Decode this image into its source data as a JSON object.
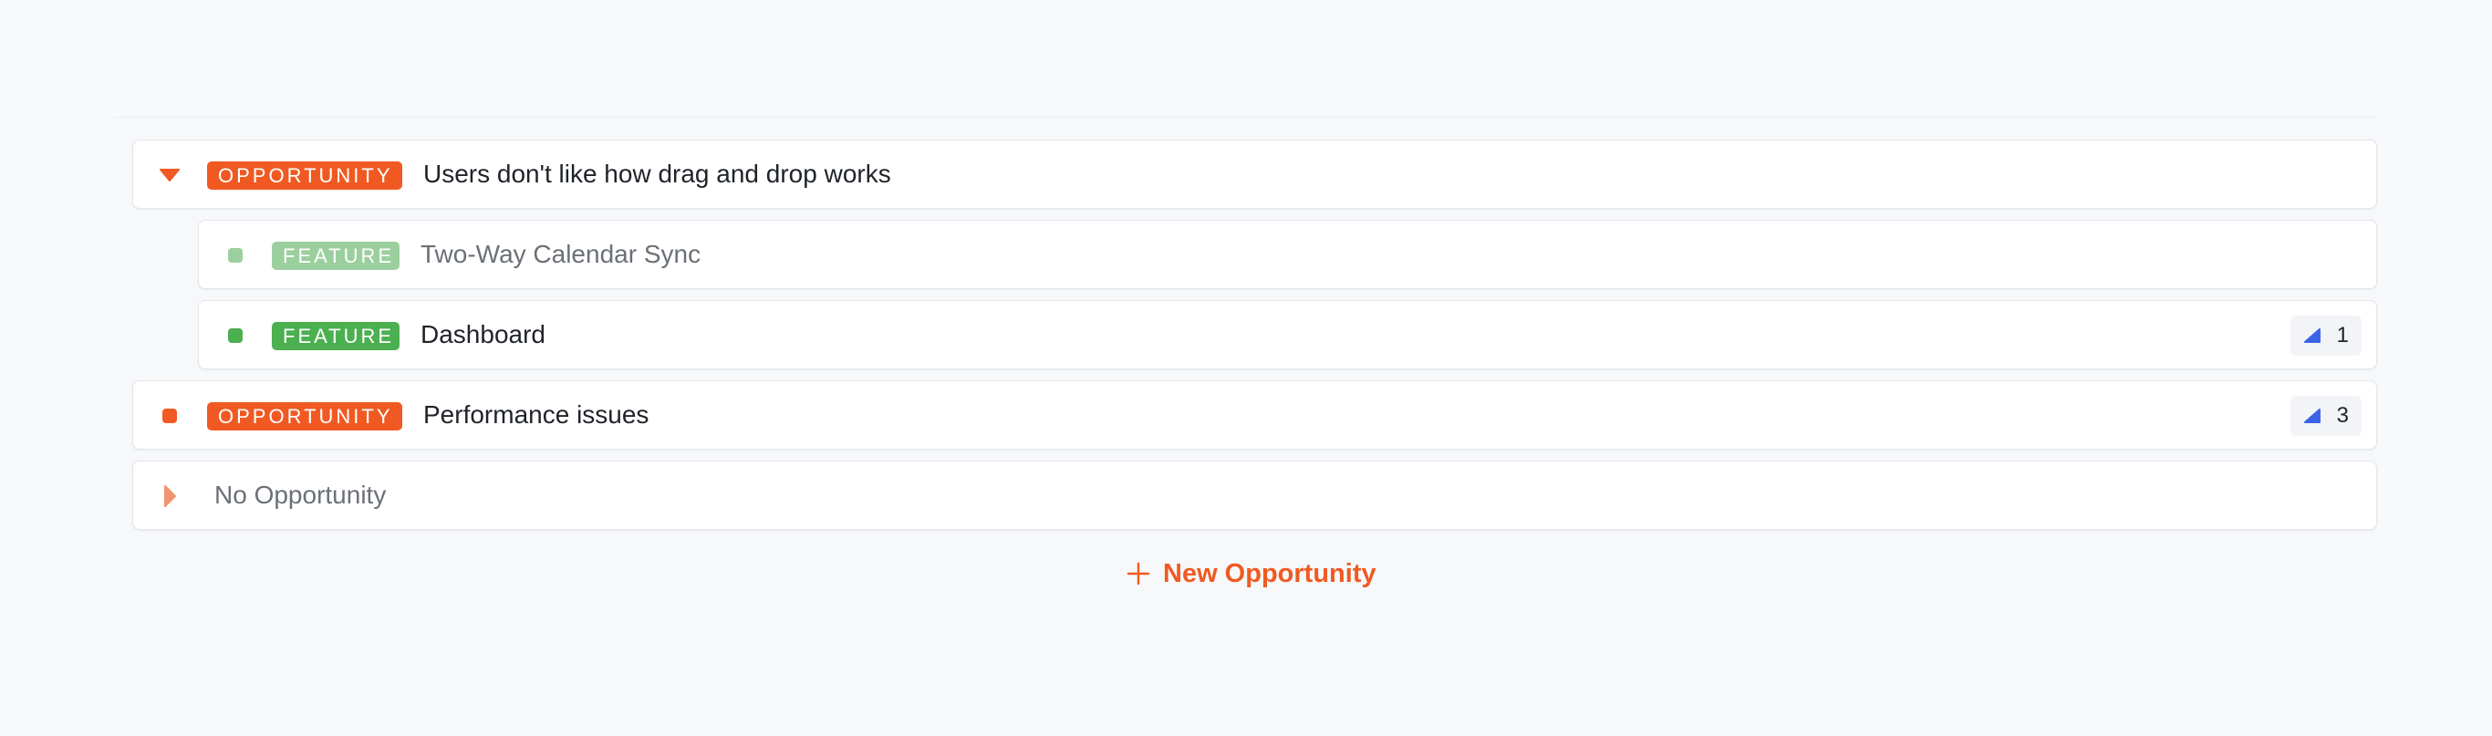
{
  "colors": {
    "opportunity": "#f05a22",
    "feature": "#4caf50",
    "feature_faded": "#9ccf9e",
    "chip_icon": "#3b63e8"
  },
  "rows": [
    {
      "kind": "opportunity",
      "tag": "OPPORTUNITY",
      "title": "Users don't like how drag and drop works",
      "icon": "caret-down-icon",
      "expanded": true
    },
    {
      "kind": "feature",
      "tag": "FEATURE",
      "title": "Two-Way Calendar Sync",
      "icon": "square-status-icon",
      "faded": true
    },
    {
      "kind": "feature",
      "tag": "FEATURE",
      "title": "Dashboard",
      "icon": "square-status-icon",
      "count": "1",
      "count_icon": "signal-icon"
    },
    {
      "kind": "opportunity",
      "tag": "OPPORTUNITY",
      "title": "Performance issues",
      "icon": "square-status-icon",
      "count": "3",
      "count_icon": "signal-icon"
    },
    {
      "kind": "group",
      "title": "No Opportunity",
      "icon": "caret-right-icon",
      "expanded": false
    }
  ],
  "new_opportunity": {
    "label": "New Opportunity",
    "icon": "plus-icon"
  }
}
